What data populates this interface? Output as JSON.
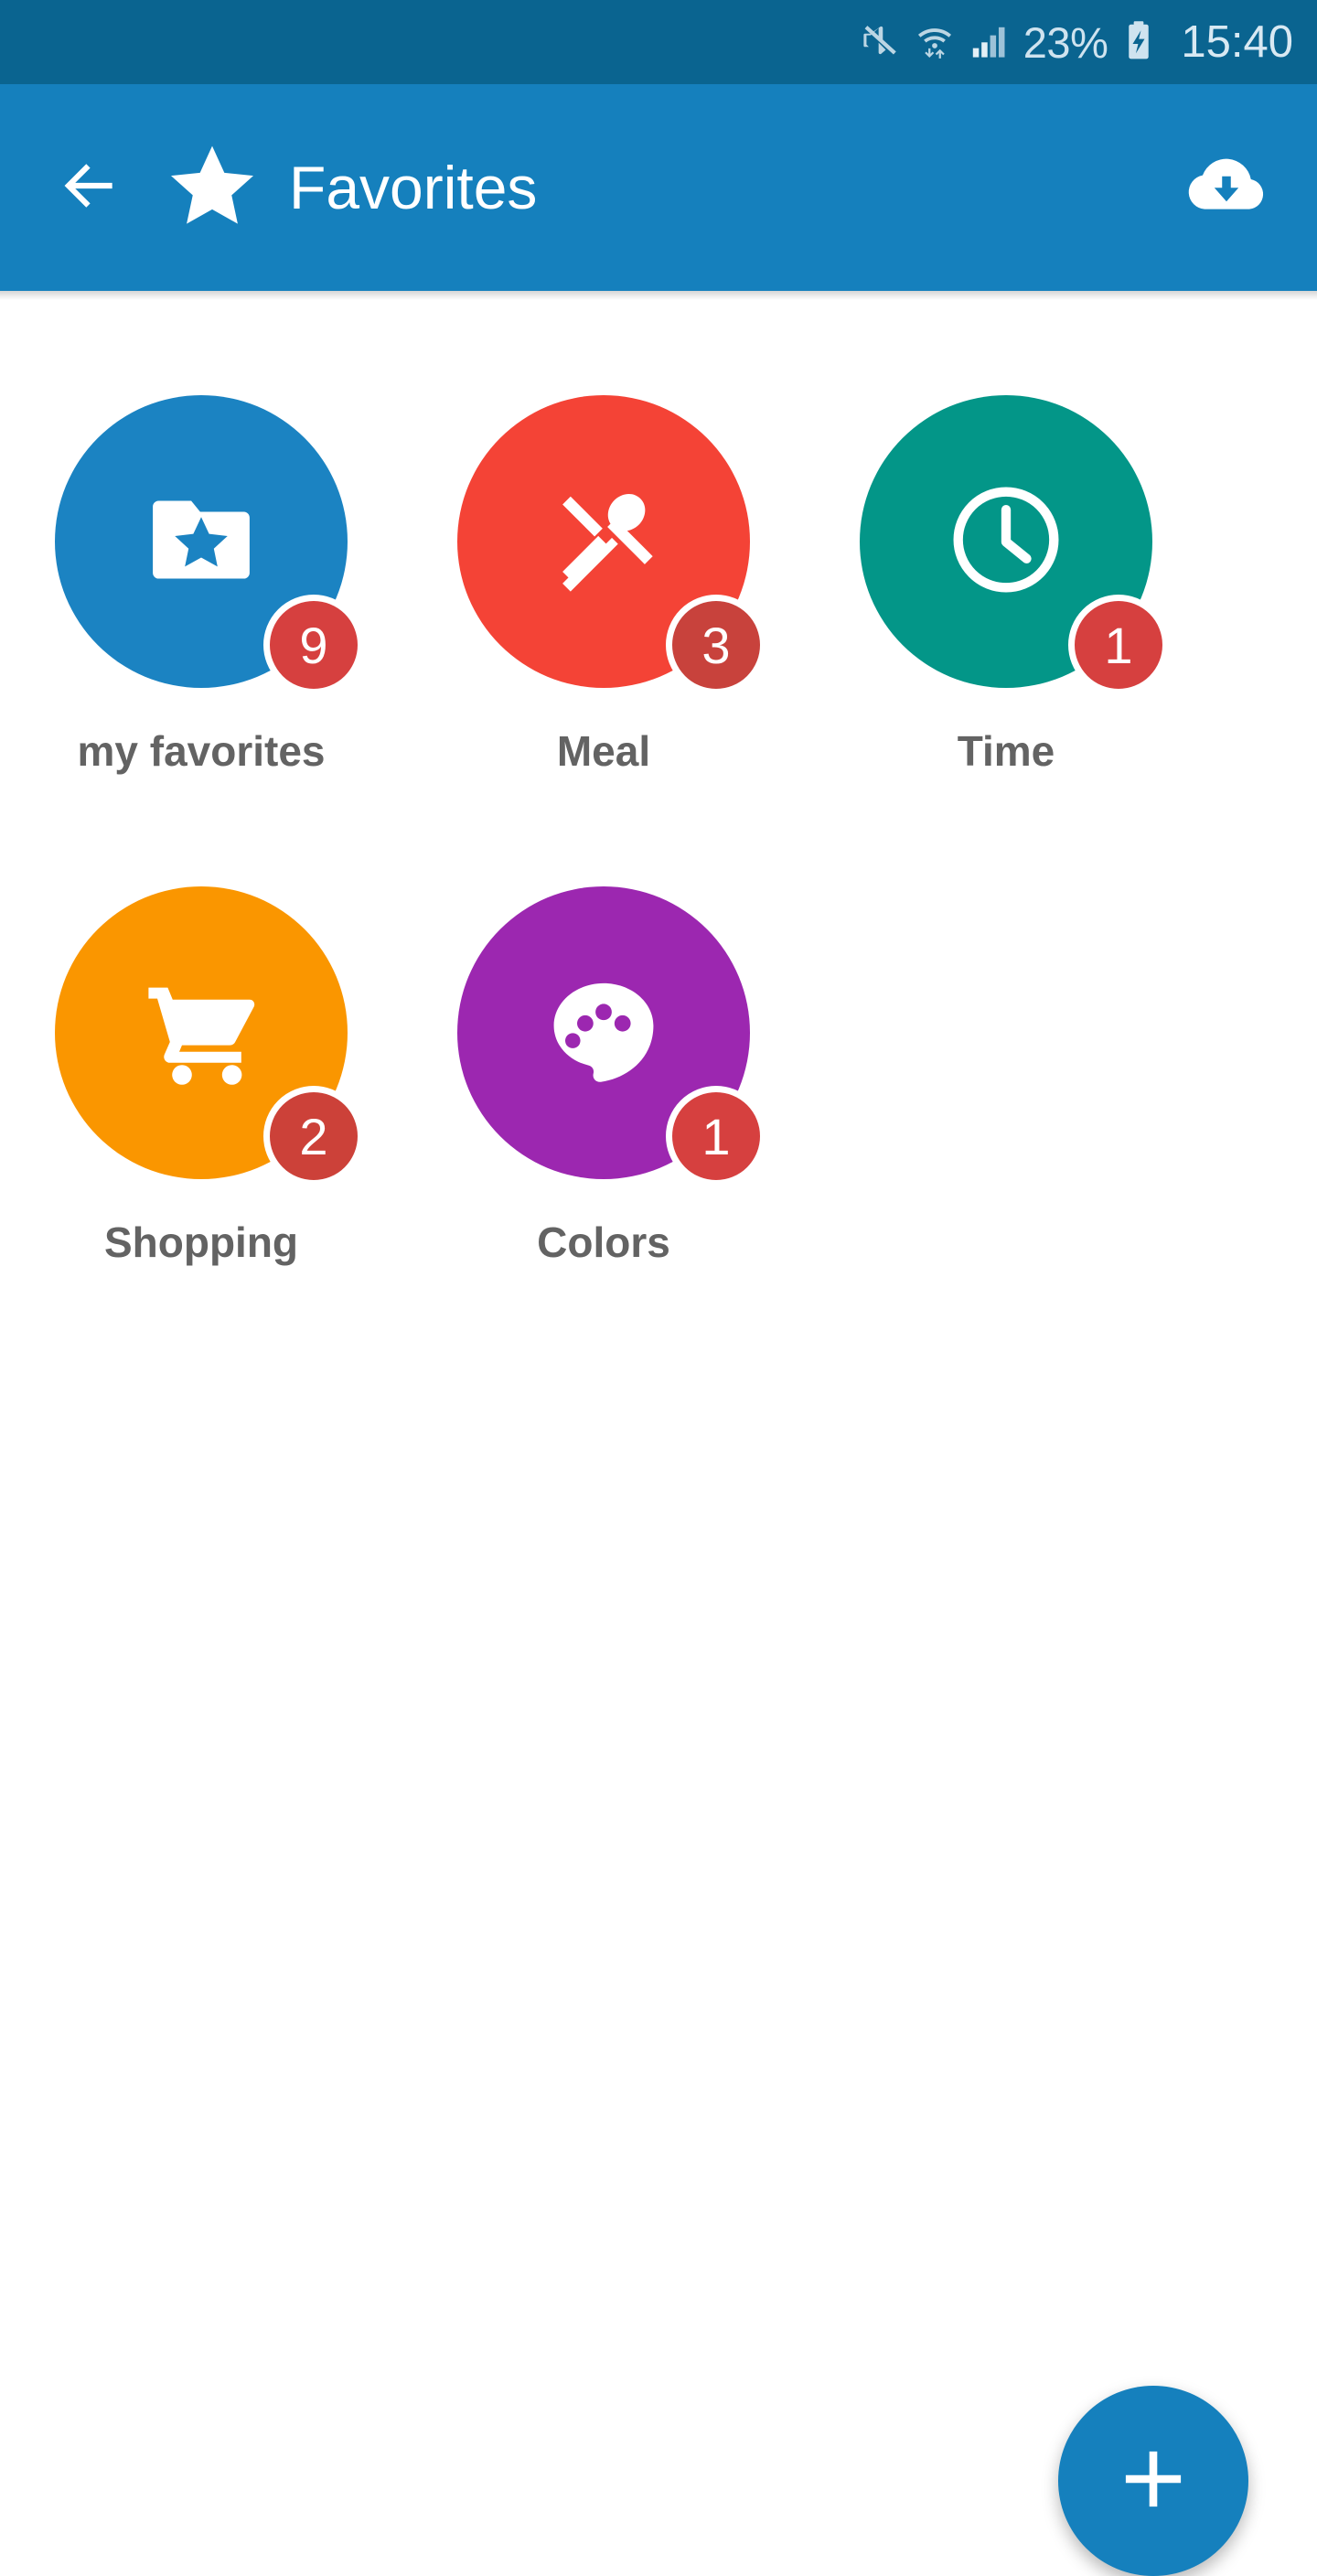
{
  "status_bar": {
    "background": "#0a6490",
    "mute_icon": "mute-icon",
    "wifi_icon": "wifi-transfer-icon",
    "signal_icon": "signal-bars-icon",
    "battery_percent": "23%",
    "battery_icon": "battery-charging-icon",
    "clock": "15:40"
  },
  "app_bar": {
    "background": "#1580bd",
    "back_icon": "back-arrow-icon",
    "logo_icon": "star-icon",
    "title": "Favorites",
    "action_icon": "cloud-download-icon"
  },
  "grid": {
    "items": [
      {
        "label": "my favorites",
        "badge": "9",
        "color": "#1b83c2",
        "icon": "folder-star-icon"
      },
      {
        "label": "Meal",
        "badge": "3",
        "color": "#f44336",
        "icon": "cutlery-icon"
      },
      {
        "label": "Time",
        "badge": "1",
        "color": "#039688",
        "icon": "clock-icon"
      },
      {
        "label": "Shopping",
        "badge": "2",
        "color": "#fa9600",
        "icon": "shopping-cart-icon"
      },
      {
        "label": "Colors",
        "badge": "1",
        "color": "#9c27b0",
        "icon": "palette-icon"
      }
    ],
    "badge_color": "#d6403f",
    "label_color": "#636363"
  },
  "fab": {
    "icon": "plus-icon",
    "color": "#1580bd"
  }
}
